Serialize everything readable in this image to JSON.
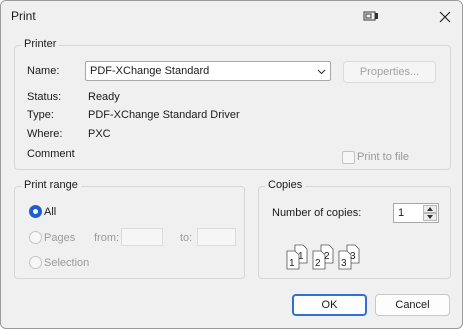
{
  "window": {
    "title": "Print",
    "icons": [
      "printer-icon",
      "close-icon"
    ]
  },
  "printer": {
    "group_title": "Printer",
    "name_label": "Name:",
    "name_value": "PDF-XChange Standard",
    "properties_label": "Properties...",
    "status_label": "Status:",
    "status_value": "Ready",
    "type_label": "Type:",
    "type_value": "PDF-XChange Standard Driver",
    "where_label": "Where:",
    "where_value": "PXC",
    "comment_label": "Comment",
    "print_to_file_label": "Print to file",
    "print_to_file_checked": false
  },
  "print_range": {
    "group_title": "Print range",
    "all_label": "All",
    "pages_label": "Pages",
    "from_label": "from:",
    "to_label": "to:",
    "from_value": "",
    "to_value": "",
    "selection_label": "Selection",
    "selected": "All"
  },
  "copies": {
    "group_title": "Copies",
    "number_label": "Number of copies:",
    "number_value": "1",
    "collate_pages": [
      "1",
      "1",
      "2",
      "2",
      "3",
      "3"
    ]
  },
  "buttons": {
    "ok_label": "OK",
    "cancel_label": "Cancel"
  },
  "colors": {
    "accent": "#1e5fd0",
    "disabled_text": "#a2a2a2"
  }
}
